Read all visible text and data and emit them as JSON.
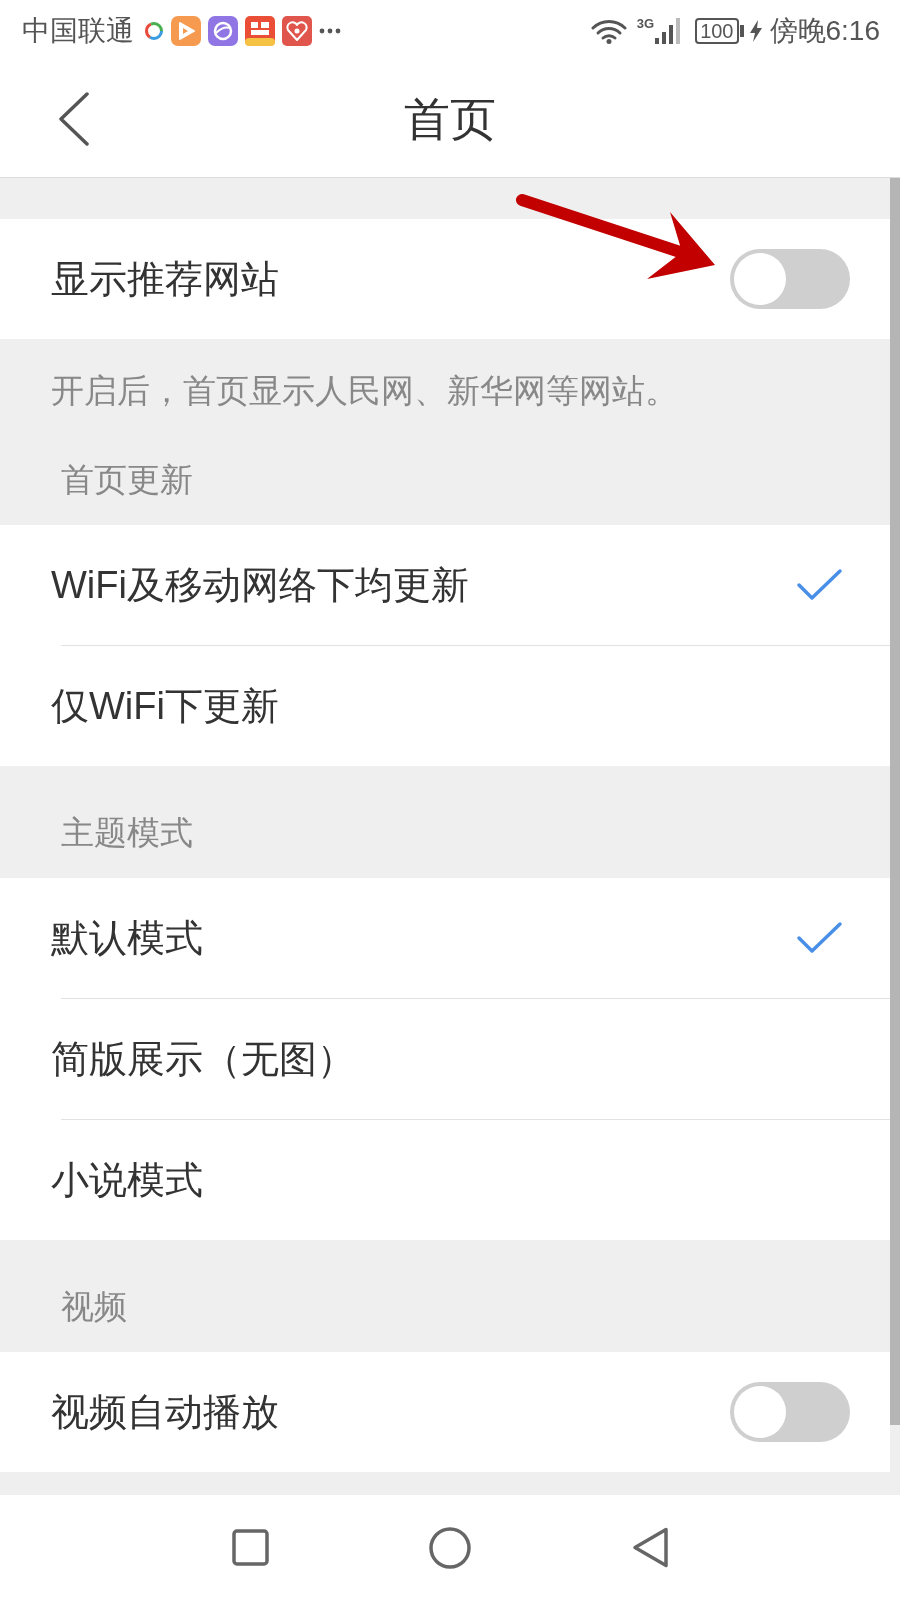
{
  "status_bar": {
    "carrier": "中国联通",
    "network_type": "3G",
    "battery": "100",
    "time": "傍晚6:16"
  },
  "header": {
    "title": "首页"
  },
  "sections": [
    {
      "items": [
        {
          "kind": "toggle",
          "label": "显示推荐网站",
          "on": false
        }
      ],
      "note": "开启后，首页显示人民网、新华网等网站。"
    },
    {
      "title": "首页更新",
      "items": [
        {
          "kind": "choice",
          "label": "WiFi及移动网络下均更新",
          "selected": true
        },
        {
          "kind": "choice",
          "label": "仅WiFi下更新",
          "selected": false
        }
      ]
    },
    {
      "title": "主题模式",
      "items": [
        {
          "kind": "choice",
          "label": "默认模式",
          "selected": true
        },
        {
          "kind": "choice",
          "label": "简版展示（无图）",
          "selected": false
        },
        {
          "kind": "choice",
          "label": "小说模式",
          "selected": false
        }
      ]
    },
    {
      "title": "视频",
      "items": [
        {
          "kind": "toggle",
          "label": "视频自动播放",
          "on": false
        }
      ]
    }
  ]
}
